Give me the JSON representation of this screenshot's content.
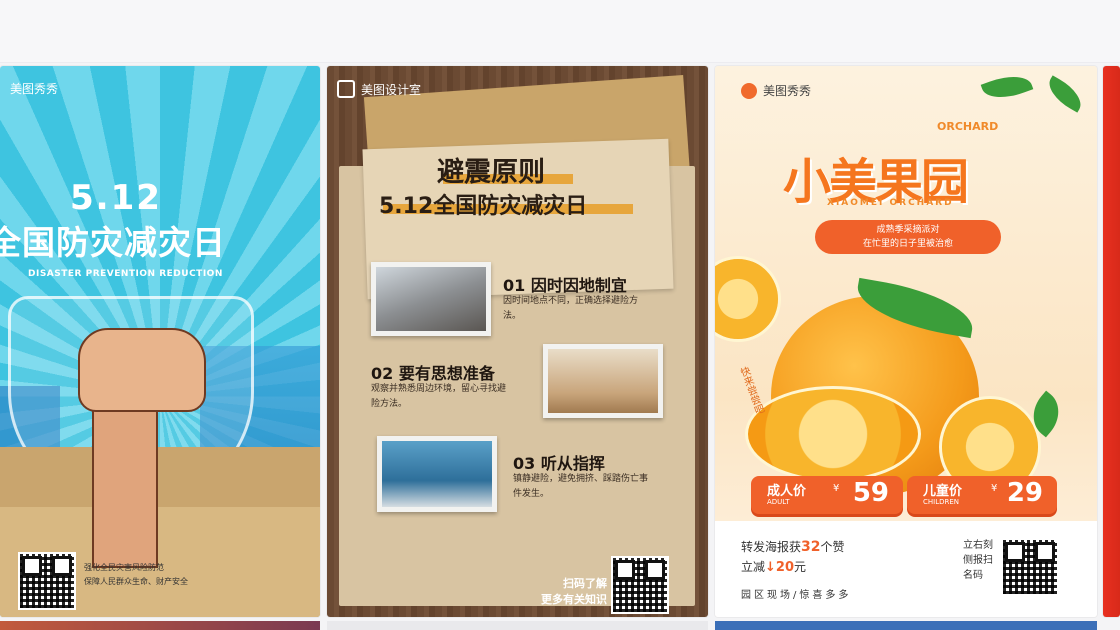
{
  "cards": [
    {
      "brand": "美图秀秀",
      "title_num": "5.12",
      "title_main": "全国防灾减灾日",
      "title_en": "DISASTER PREVENTION REDUCTION",
      "footer_line1": "强化全民灾害风险防范",
      "footer_line2": "保障人民群众生命、财产安全"
    },
    {
      "brand": "美图设计室",
      "title1": "避震原则",
      "title2": "5.12全国防灾减灾日",
      "items": [
        {
          "heading": "01 因时因地制宜",
          "desc": "因时间地点不同，正确选择避险方法。"
        },
        {
          "heading": "02 要有思想准备",
          "desc": "观察并熟悉周边环境，留心寻找避险方法。"
        },
        {
          "heading": "03 听从指挥",
          "desc": "镇静避险，避免拥挤、踩踏伤亡事件发生。"
        }
      ],
      "scan_line1": "扫码了解",
      "scan_line2": "更多有关知识"
    },
    {
      "brand": "美图秀秀",
      "orchard_en": "ORCHARD",
      "title": "小美果园",
      "title_en": "XIAOMEI ORCHARD",
      "pill_line1": "成熟季采摘派对",
      "pill_line2": "在忙里的日子里被治愈",
      "vertical": "快来尝尝吧",
      "adult_label": "成人价",
      "adult_sub": "ADULT",
      "adult_price": "59",
      "child_label": "儿童价",
      "child_sub": "CHILDREN",
      "child_price": "29",
      "currency": "¥",
      "share_prefix": "转发海报获",
      "share_num": "32",
      "share_suffix": "个赞",
      "cut_prefix": "立减",
      "cut_amount": "↓20",
      "cut_suffix": "元",
      "park": "园区现场/惊喜多多",
      "scan_vert": "立右刻侧报扫名码"
    }
  ],
  "colors": {
    "orange": "#f0612a",
    "cyan": "#3ec4e0",
    "wood": "#6b4a33"
  }
}
